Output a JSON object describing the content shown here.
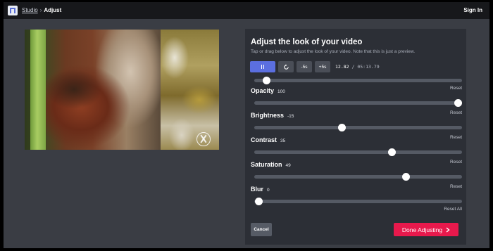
{
  "header": {
    "breadcrumb_root": "Studio",
    "breadcrumb_sep": "›",
    "breadcrumb_current": "Adjust",
    "signin_label": "Sign In"
  },
  "video": {
    "watermark_icon": "circle-logo-icon"
  },
  "panel": {
    "title": "Adjust the look of your video",
    "subtitle": "Tap or drag below to adjust the look of your video. Note that this is just a preview.",
    "controls": {
      "pause_icon": "pause-icon",
      "reload_icon": "reload-icon",
      "back_label": "-5s",
      "fwd_label": "+5s"
    },
    "time_current": "12.82",
    "time_separator": "/",
    "time_total": "05:13.79",
    "seek_fraction": 0.04,
    "adjustments": [
      {
        "label": "Opacity",
        "value": "100",
        "fraction": 1.0,
        "reset": "Reset"
      },
      {
        "label": "Brightness",
        "value": "-15",
        "fraction": 0.42,
        "reset": "Reset"
      },
      {
        "label": "Contrast",
        "value": "35",
        "fraction": 0.67,
        "reset": "Reset"
      },
      {
        "label": "Saturation",
        "value": "49",
        "fraction": 0.74,
        "reset": "Reset"
      },
      {
        "label": "Blur",
        "value": "0",
        "fraction": 0.0,
        "reset": "Reset"
      }
    ],
    "reset_all": "Reset All",
    "cancel_label": "Cancel",
    "done_label": "Done Adjusting",
    "done_icon": "chevron-right-icon",
    "accent_color": "#5b6fe0",
    "done_color": "#e8194c"
  }
}
